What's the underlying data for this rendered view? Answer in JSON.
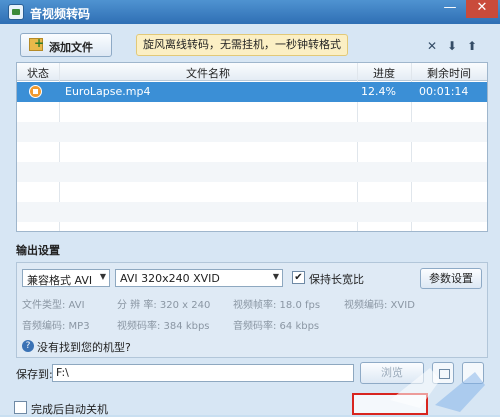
{
  "window": {
    "title": "音视频转码",
    "minimize": "—",
    "close": "✕"
  },
  "toolbar": {
    "add_file_label": "添加文件",
    "promo_text": "旋风离线转码，无需挂机，一秒钟转格式",
    "icons": [
      "x-icon",
      "arrow-down-icon",
      "arrow-up-icon"
    ]
  },
  "table": {
    "columns": [
      "状态",
      "文件名称",
      "进度",
      "剩余时间"
    ],
    "rows": [
      {
        "status_icon": "converting-icon",
        "filename": "EuroLapse.mp4",
        "progress": "12.4%",
        "remaining": "00:01:14"
      }
    ]
  },
  "output": {
    "section_title": "输出设置",
    "format": "兼容格式 AVI",
    "preset": "AVI 320x240 XVID",
    "keep_ratio_label": "保持长宽比",
    "keep_ratio_checked": true,
    "param_button": "参数设置",
    "info": {
      "file_type": "文件类型:  AVI",
      "resolution": "分 辨 率:  320 x 240",
      "frame_rate": "视频帧率:  18.0 fps",
      "video_codec": "视频编码:  XVID",
      "audio_codec": "音频编码:  MP3",
      "video_bitrate": "视频码率:  384 kbps",
      "audio_bitrate": "音频码率:  64 kbps"
    },
    "help_text": "没有找到您的机型?"
  },
  "save": {
    "label": "保存到:",
    "path": "F:\\",
    "browse_label": "浏览"
  },
  "footer": {
    "shutdown_label": "完成后自动关机"
  },
  "colors": {
    "accent": "#3b8fd6",
    "highlight": "#d8251f"
  }
}
